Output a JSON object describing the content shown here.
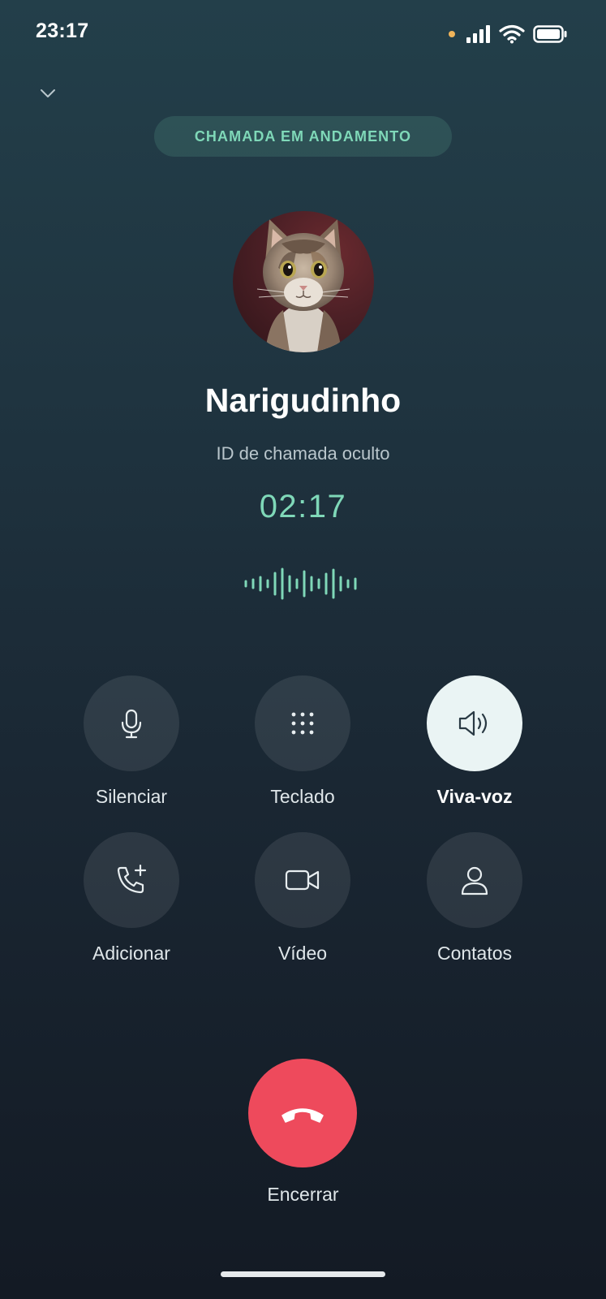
{
  "status_bar": {
    "time": "23:17",
    "icons": [
      "privacy-dot",
      "signal-icon",
      "wifi-icon",
      "battery-icon"
    ],
    "privacy_dot_color": "#f0b45a"
  },
  "header": {
    "collapse_icon": "chevron-down-icon",
    "status_pill": "CHAMADA EM ANDAMENTO"
  },
  "contact": {
    "name": "Narigudinho",
    "caller_id": "ID de chamada oculto",
    "duration": "02:17"
  },
  "controls": [
    {
      "label": "Silenciar",
      "icon": "microphone-icon",
      "active": false
    },
    {
      "label": "Teclado",
      "icon": "keypad-icon",
      "active": false
    },
    {
      "label": "Viva-voz",
      "icon": "speaker-icon",
      "active": true
    },
    {
      "label": "Adicionar",
      "icon": "add-call-icon",
      "active": false
    },
    {
      "label": "Vídeo",
      "icon": "video-icon",
      "active": false
    },
    {
      "label": "Contatos",
      "icon": "contact-icon",
      "active": false
    }
  ],
  "end_call": {
    "label": "Encerrar",
    "icon": "hang-up-icon"
  },
  "colors": {
    "accent": "#7fd8b8",
    "end_call": "#ee4a5c",
    "active_control": "#eaf4f4"
  }
}
